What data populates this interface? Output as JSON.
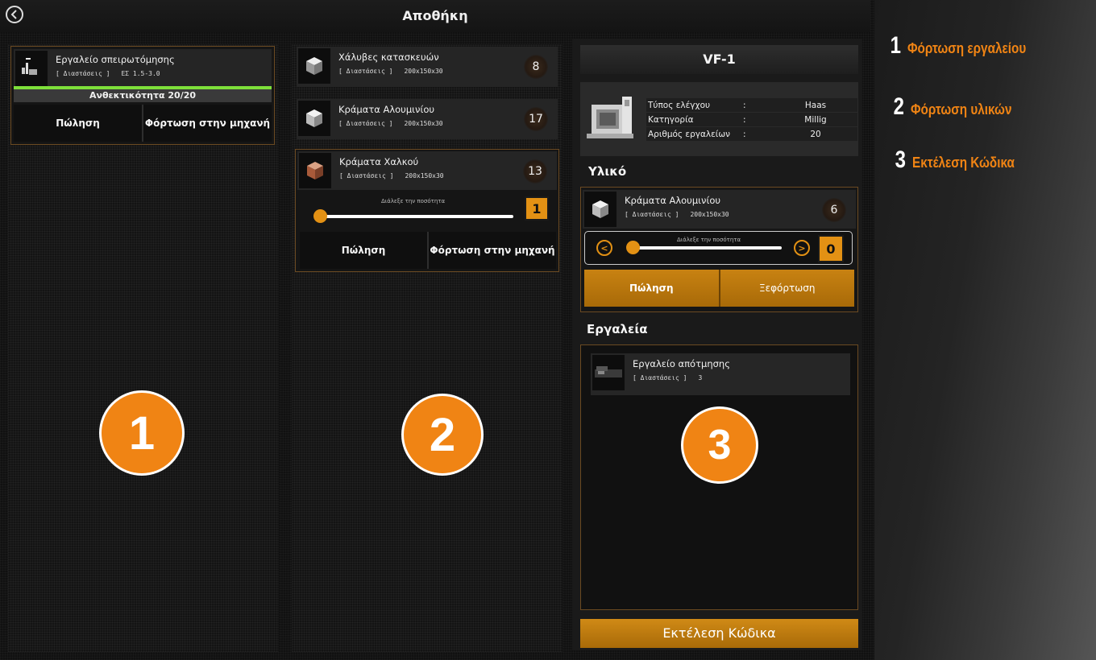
{
  "header": {
    "title": "Αποθήκη"
  },
  "tools_column": {
    "item": {
      "name": "Εργαλείο σπειρωτόμησης",
      "dims_label": "[ Διαστάσεις ]",
      "dims_value": "ΕΣ 1.5-3.0",
      "durability": "Ανθεκτικότητα 20/20",
      "durability_fraction": 1.0
    },
    "sell_label": "Πώληση",
    "load_label": "Φόρτωση στην  μηχανή",
    "badge": "1"
  },
  "materials_column": {
    "items": [
      {
        "name": "Χάλυβες κατασκευών",
        "dims_label": "[ Διαστάσεις ]",
        "dims_value": "200x150x30",
        "count": "8"
      },
      {
        "name": "Κράματα Αλουμινίου",
        "dims_label": "[ Διαστάσεις ]",
        "dims_value": "200x150x30",
        "count": "17"
      },
      {
        "name": "Κράματα Χαλκού",
        "dims_label": "[ Διαστάσεις ]",
        "dims_value": "200x150x30",
        "count": "13"
      }
    ],
    "slider_label": "Διάλεξε την ποσότητα",
    "quantity": "1",
    "sell_label": "Πώληση",
    "load_label": "Φόρτωση στην  μηχανή",
    "badge": "2"
  },
  "machine_column": {
    "machine_name": "VF-1",
    "info": [
      {
        "label": "Τύπος ελέγχου",
        "sep": ":",
        "value": "Haas"
      },
      {
        "label": "Κατηγορία",
        "sep": ":",
        "value": "Millig"
      },
      {
        "label": "Αριθμός εργαλείων",
        "sep": ":",
        "value": "20"
      }
    ],
    "material_heading": "Υλικό",
    "material": {
      "name": "Κράματα Αλουμινίου",
      "dims_label": "[ Διαστάσεις ]",
      "dims_value": "200x150x30",
      "count": "6"
    },
    "slider_label": "Διάλεξε την ποσότητα",
    "quantity": "0",
    "sell_label": "Πώληση",
    "unload_label": "Ξεφόρτωση",
    "tools_heading": "Εργαλεία",
    "tool": {
      "name": "Εργαλείο απότμησης",
      "dims_label": "[ Διαστάσεις ]",
      "dims_value": "3"
    },
    "badge": "3",
    "execute_label": "Εκτέλεση Κώδικα"
  },
  "steps": [
    {
      "num": "1",
      "text": "Φόρτωση εργαλείου"
    },
    {
      "num": "2",
      "text": "Φόρτωση υλικών"
    },
    {
      "num": "3",
      "text": "Εκτέλεση Κώδικα"
    }
  ],
  "colors": {
    "accent": "#f08414",
    "durability_bar": "#7ee03a"
  }
}
